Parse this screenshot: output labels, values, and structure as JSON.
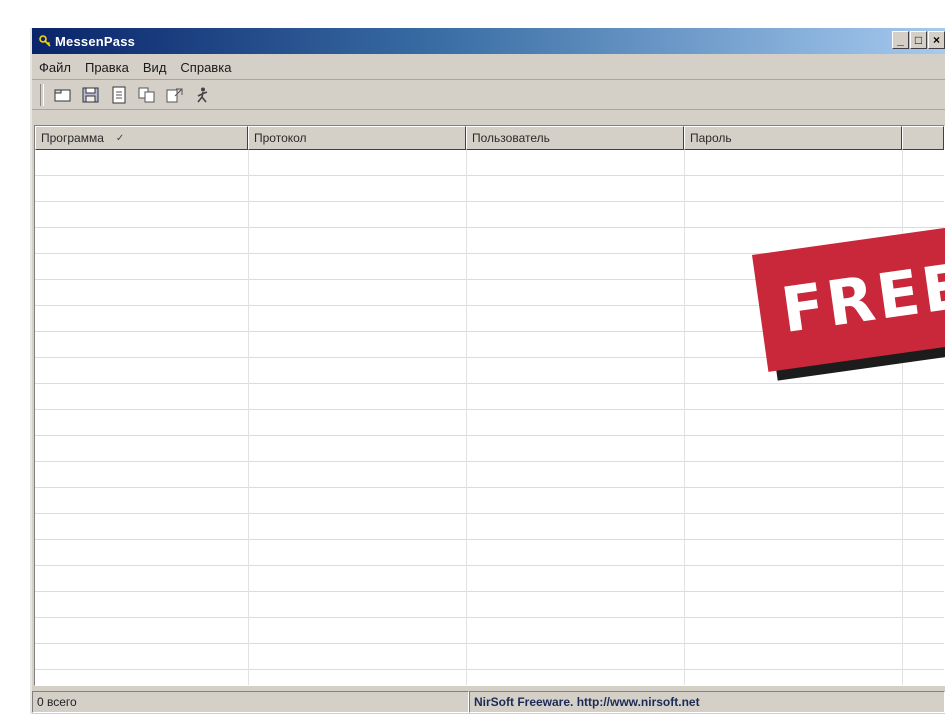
{
  "window": {
    "title": "MessenPass",
    "controls": {
      "minimize": "_",
      "maximize": "□",
      "close": "×"
    }
  },
  "menu": [
    "Файл",
    "Правка",
    "Вид",
    "Справка"
  ],
  "toolbar": [
    "new-icon",
    "save-icon",
    "properties-icon",
    "copy-icon",
    "html-report-icon",
    "exit-icon"
  ],
  "columns": [
    {
      "label": "Программа",
      "sorted": true,
      "sort_indicator": "✓"
    },
    {
      "label": "Протокол"
    },
    {
      "label": "Пользователь"
    },
    {
      "label": "Пароль"
    }
  ],
  "status": {
    "count": "0 всего",
    "credit": "NirSoft Freeware.  http://www.nirsoft.net"
  },
  "overlay": {
    "text": "FREE"
  },
  "colors": {
    "banner": "#c8283a",
    "title_start": "#0a246a",
    "title_end": "#a6caf0"
  }
}
